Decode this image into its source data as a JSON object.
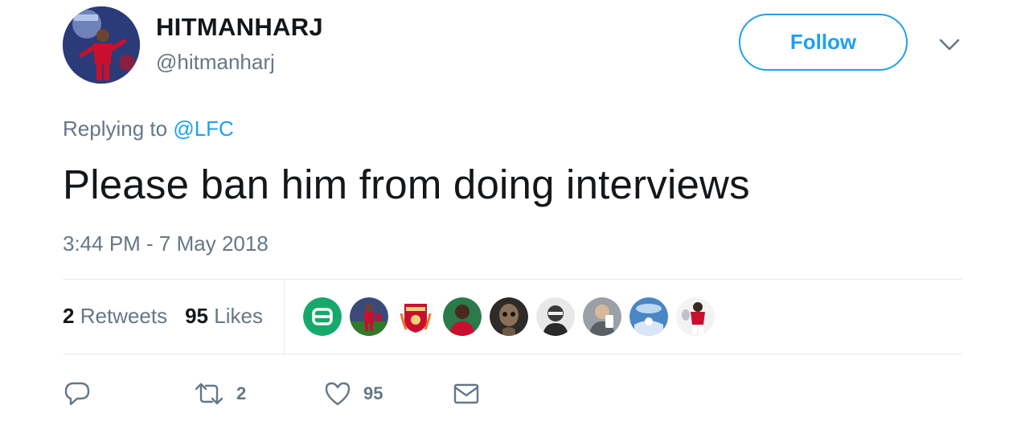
{
  "user": {
    "display_name": "HITMANHARJ",
    "handle": "@hitmanharj"
  },
  "header": {
    "follow_label": "Follow"
  },
  "reply": {
    "prefix": "Replying to",
    "mention": "@LFC"
  },
  "tweet": {
    "text": "Please ban him from doing interviews",
    "timestamp": "3:44 PM - 7 May 2018"
  },
  "stats": {
    "retweets_count": "2",
    "retweets_label": "Retweets",
    "likes_count": "95",
    "likes_label": "Likes"
  },
  "likers": [
    {
      "icon": "green-app-avatar",
      "color": "#17a86b"
    },
    {
      "icon": "player-avatar",
      "color": "#2f6a2a"
    },
    {
      "icon": "liverpool-crest-avatar",
      "color": "#c8102e"
    },
    {
      "icon": "player-avatar",
      "color": "#7a2a22"
    },
    {
      "icon": "groot-avatar",
      "color": "#6b5a44"
    },
    {
      "icon": "person-avatar",
      "color": "#4a4a4a"
    },
    {
      "icon": "person-avatar",
      "color": "#8a8f94"
    },
    {
      "icon": "sky-avatar",
      "color": "#4a86c5"
    },
    {
      "icon": "player-avatar",
      "color": "#b0182a"
    }
  ],
  "actions": {
    "reply_count": "",
    "retweet_count": "2",
    "like_count": "95"
  },
  "colors": {
    "accent": "#1da1f2",
    "secondary_text": "#657786",
    "primary_text": "#14171a",
    "divider": "#e6ecf0"
  }
}
